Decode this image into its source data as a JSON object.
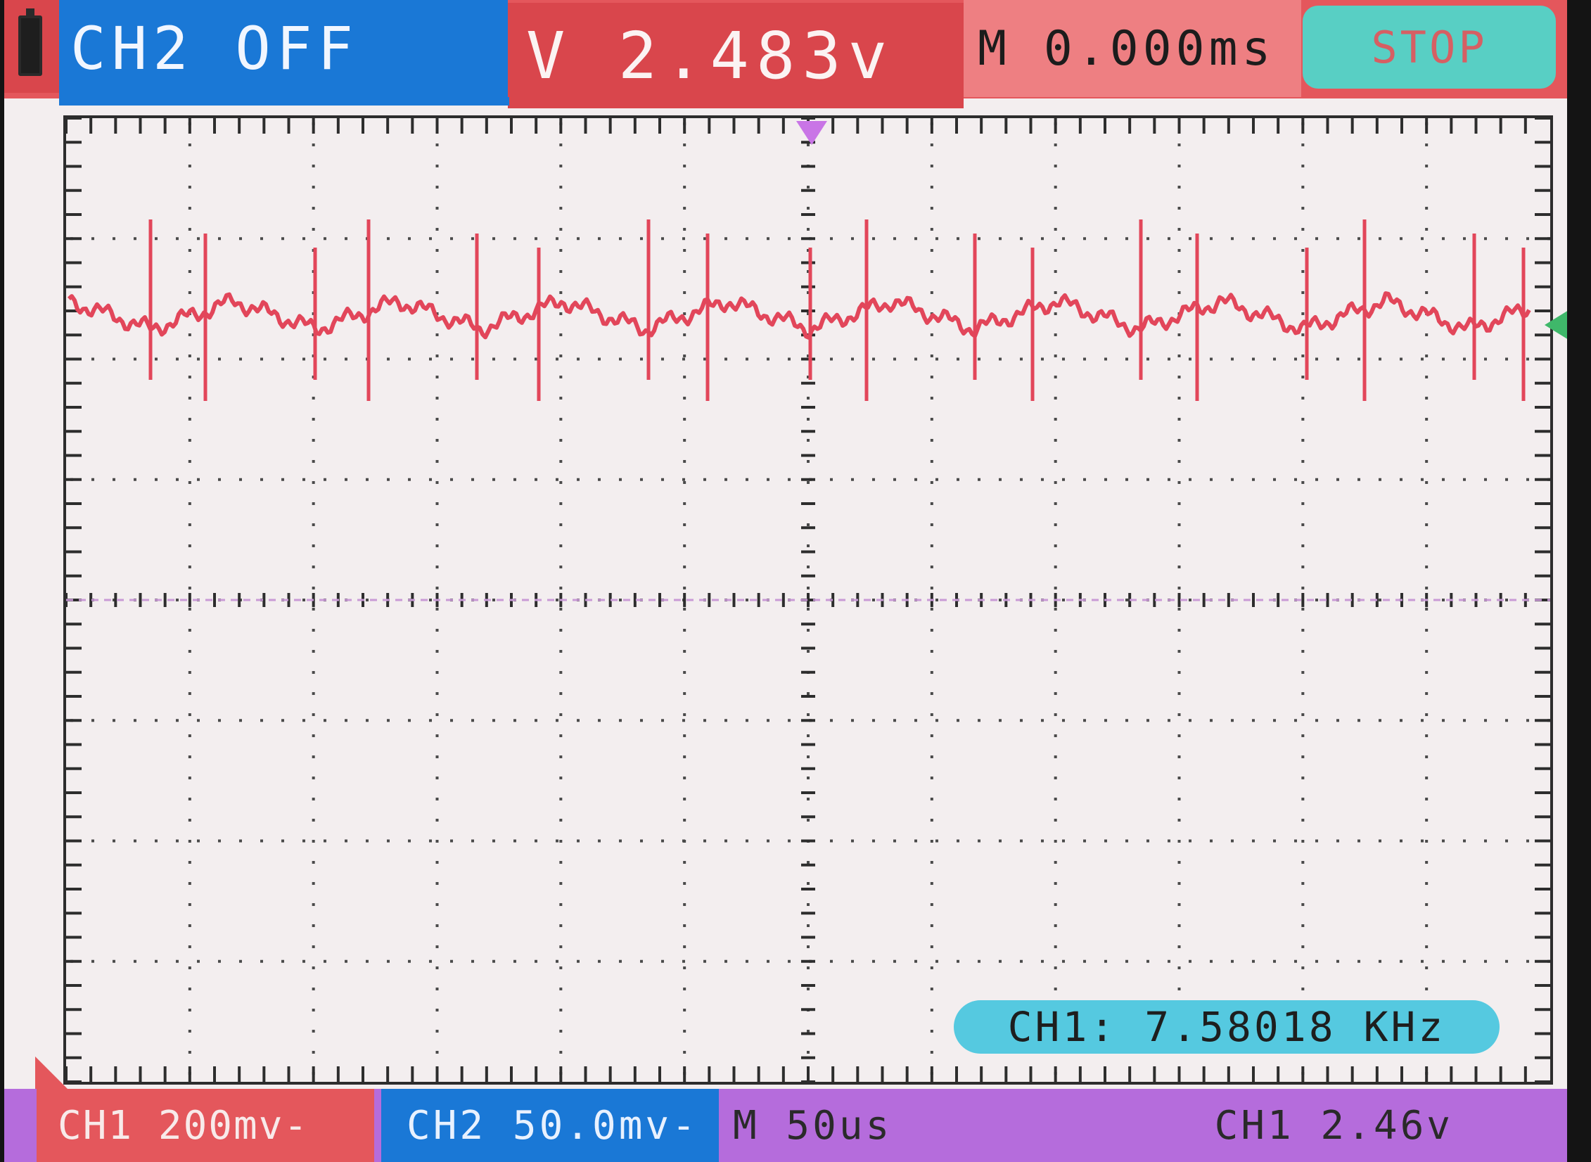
{
  "header": {
    "ch2_status": "CH2 OFF",
    "voltage_readout": "V 2.483v",
    "time_readout": "M 0.000ms",
    "stop_label": "STOP"
  },
  "measurement": {
    "frequency_label": "CH1: 7.58018 KHz"
  },
  "footer": {
    "ch1_scale": "CH1 200mv-",
    "ch2_scale": "CH2 50.0mv-",
    "timebase": "M 50us",
    "trigger_level": "CH1 2.46v"
  },
  "icons": [
    "battery-icon",
    "trigger-position-marker",
    "ch1-ground-level-marker"
  ],
  "colors": {
    "ch1": "#e4575c",
    "ch2": "#1a78d6",
    "trace": "#e2465a",
    "grid_background": "#f3eeef",
    "stop_button": "#58cfc4",
    "bottom_bar": "#b56cdc",
    "level_marker": "#3fb86a",
    "trigger_marker": "#c975e6"
  }
}
